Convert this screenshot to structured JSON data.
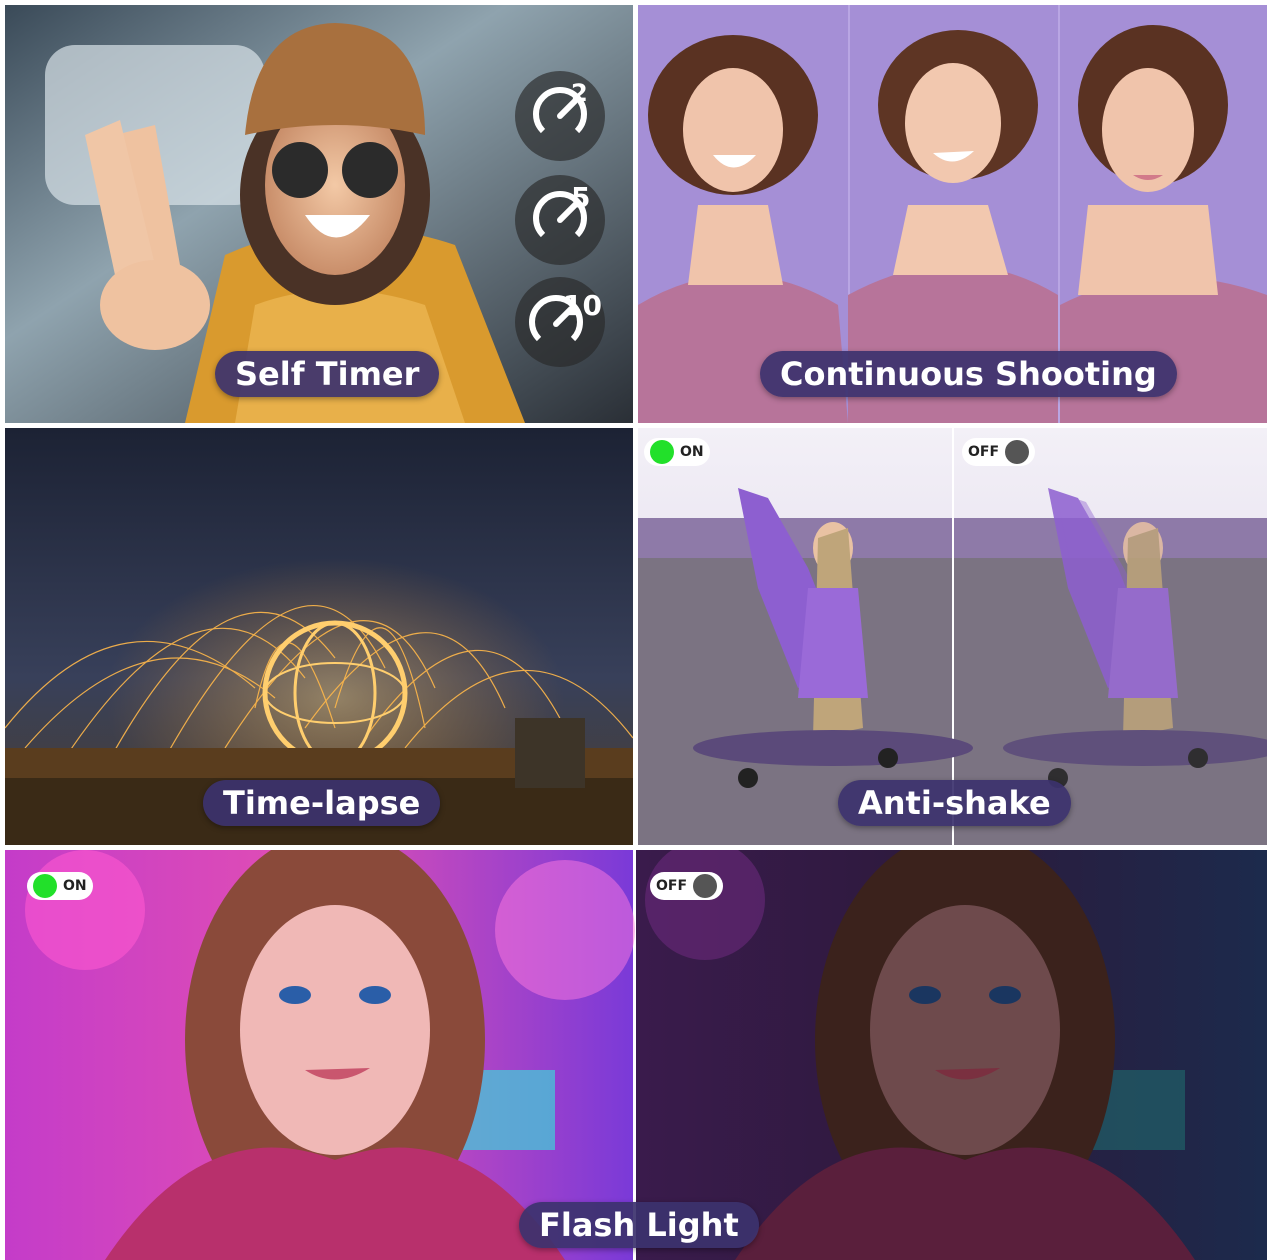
{
  "panels": {
    "self_timer": {
      "label": "Self Timer",
      "timers": [
        "2",
        "5",
        "10"
      ]
    },
    "continuous_shooting": {
      "label": "Continuous Shooting"
    },
    "time_lapse": {
      "label": "Time-lapse"
    },
    "anti_shake": {
      "label": "Anti-shake",
      "left_toggle": "ON",
      "right_toggle": "OFF"
    },
    "flash_light": {
      "label": "Flash Light",
      "left_toggle": "ON",
      "right_toggle": "OFF"
    }
  },
  "colors": {
    "pill_bg": "#3c326e",
    "toggle_on": "#22e02a",
    "toggle_off": "#555555",
    "purple_bg": "#a58fd6"
  }
}
